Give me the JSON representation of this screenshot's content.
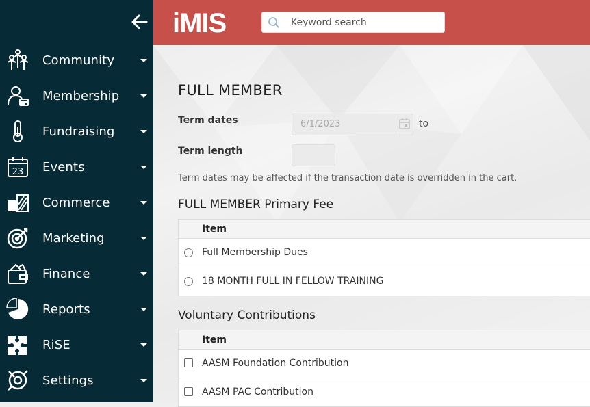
{
  "app": {
    "logo_text": "iMIS",
    "brand_color": "#c7504a",
    "sidebar_color": "#072a37"
  },
  "search": {
    "placeholder": "Keyword search"
  },
  "sidebar": {
    "items": [
      {
        "label": "Community",
        "icon": "community-icon"
      },
      {
        "label": "Membership",
        "icon": "membership-icon"
      },
      {
        "label": "Fundraising",
        "icon": "fundraising-icon"
      },
      {
        "label": "Events",
        "icon": "calendar-icon"
      },
      {
        "label": "Commerce",
        "icon": "commerce-icon"
      },
      {
        "label": "Marketing",
        "icon": "target-icon"
      },
      {
        "label": "Finance",
        "icon": "wallet-icon"
      },
      {
        "label": "Reports",
        "icon": "pie-chart-icon"
      },
      {
        "label": "RiSE",
        "icon": "puzzle-icon"
      },
      {
        "label": "Settings",
        "icon": "settings-icon"
      }
    ]
  },
  "main": {
    "title": "FULL MEMBER",
    "term_dates_label": "Term dates",
    "term_start_value": "6/1/2023",
    "to_label": "to",
    "term_length_label": "Term length",
    "term_length_value": "",
    "note": "Term dates may be affected if the transaction date is overridden in the cart.",
    "primary_fee": {
      "heading": "FULL MEMBER Primary Fee",
      "column": "Item",
      "rows": [
        "Full Membership Dues",
        "18 MONTH FULL IN FELLOW TRAINING"
      ]
    },
    "voluntary": {
      "heading": "Voluntary Contributions",
      "column": "Item",
      "rows": [
        "AASM Foundation Contribution",
        "AASM PAC Contribution"
      ]
    }
  }
}
